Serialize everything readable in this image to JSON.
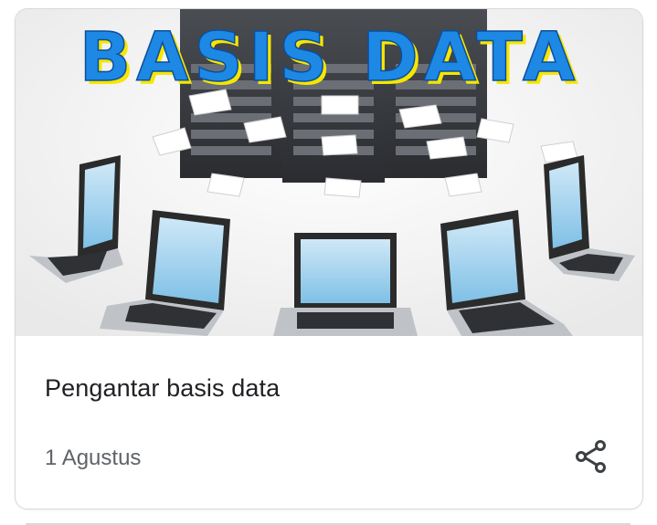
{
  "card": {
    "image": {
      "overlay_text": "BASIS DATA",
      "text_fill_color": "#1e88e5",
      "text_shadow_color": "#f6e600"
    },
    "title": "Pengantar basis data",
    "date": "1 Agustus",
    "share_icon": "share-icon"
  },
  "colors": {
    "title": "#202124",
    "meta": "#5f6368",
    "border": "#d9d9d9"
  }
}
